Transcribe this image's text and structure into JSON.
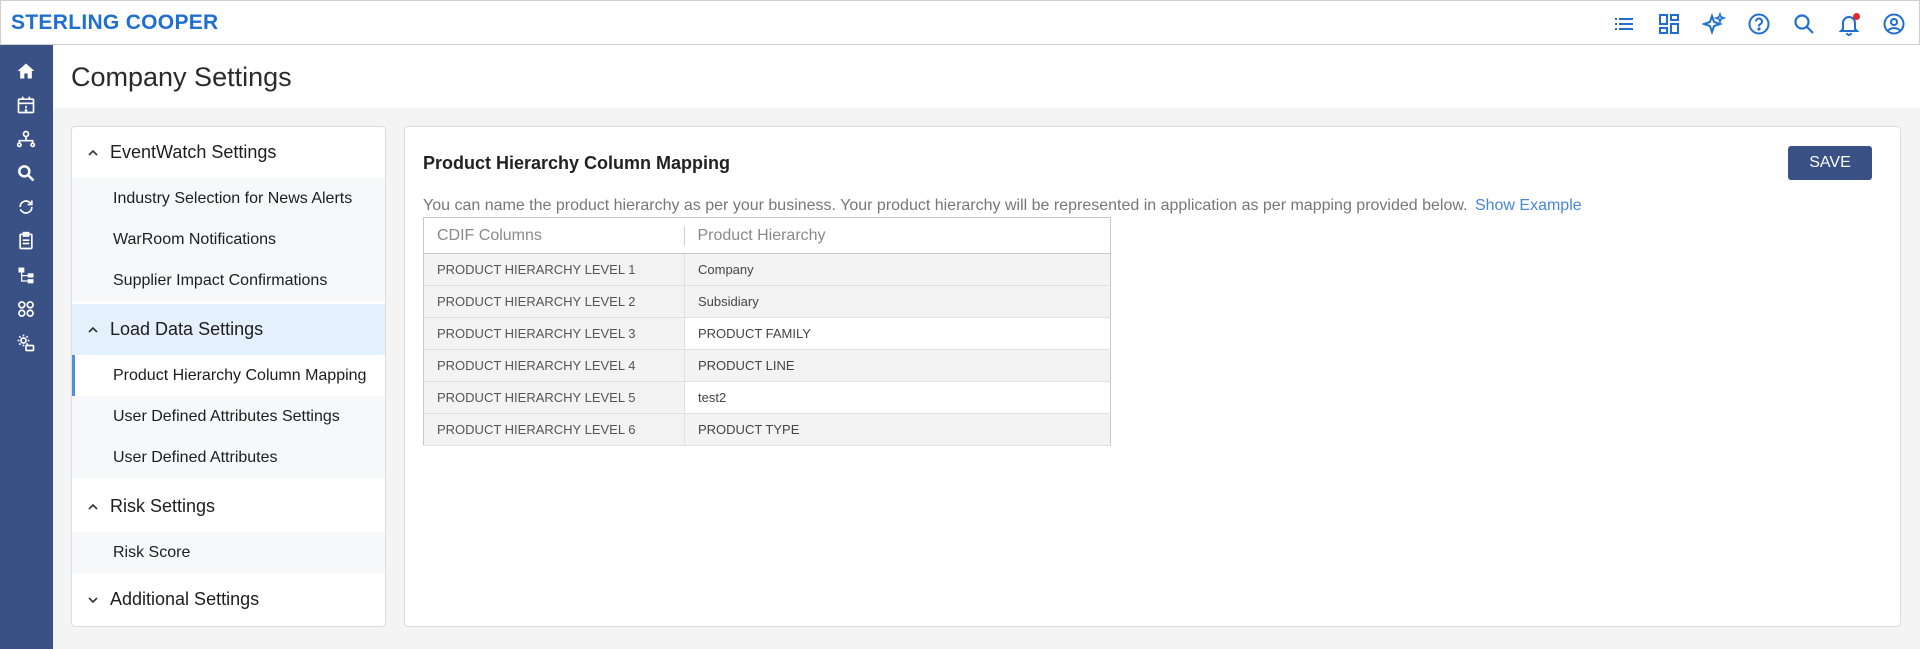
{
  "brand": "STERLING COOPER",
  "topbar": {
    "icons": [
      "list-icon",
      "dashboard-icon",
      "sparkle-icon",
      "help-icon",
      "search-icon",
      "bell-icon",
      "account-icon"
    ]
  },
  "rail": {
    "icons": [
      "home-icon",
      "calendar-alert-icon",
      "network-icon",
      "search-icon",
      "sync-icon",
      "clipboard-icon",
      "hierarchy-icon",
      "apps-icon",
      "settings-icon"
    ]
  },
  "page": {
    "title": "Company Settings"
  },
  "nav": {
    "sections": [
      {
        "label": "EventWatch Settings",
        "expanded": true,
        "items": [
          "Industry Selection for News Alerts",
          "WarRoom Notifications",
          "Supplier Impact Confirmations"
        ]
      },
      {
        "label": "Load Data Settings",
        "expanded": true,
        "active": true,
        "items": [
          "Product Hierarchy Column Mapping",
          "User Defined Attributes Settings",
          "User Defined Attributes"
        ]
      },
      {
        "label": "Risk Settings",
        "expanded": true,
        "items": [
          "Risk Score"
        ]
      },
      {
        "label": "Additional Settings",
        "expanded": false,
        "items": []
      }
    ],
    "selected_item": "Product Hierarchy Column Mapping"
  },
  "main": {
    "title": "Product Hierarchy Column Mapping",
    "save_label": "SAVE",
    "description": "You can name the product hierarchy as per your business. Your product hierarchy will be represented in application as per mapping provided below.",
    "example_link": "Show Example",
    "table": {
      "headers": [
        "CDIF Columns",
        "Product Hierarchy"
      ],
      "rows": [
        [
          "PRODUCT HIERARCHY LEVEL 1",
          "Company"
        ],
        [
          "PRODUCT HIERARCHY LEVEL 2",
          "Subsidiary"
        ],
        [
          "PRODUCT HIERARCHY LEVEL 3",
          "PRODUCT FAMILY"
        ],
        [
          "PRODUCT HIERARCHY LEVEL 4",
          "PRODUCT LINE"
        ],
        [
          "PRODUCT HIERARCHY LEVEL 5",
          "test2"
        ],
        [
          "PRODUCT HIERARCHY LEVEL 6",
          "PRODUCT TYPE"
        ]
      ]
    }
  },
  "colors": {
    "brand": "#1f6fd1",
    "rail": "#3a5185",
    "accent": "#4a90e2",
    "link": "#4a86d8",
    "active_section": "#e4f0fc"
  }
}
